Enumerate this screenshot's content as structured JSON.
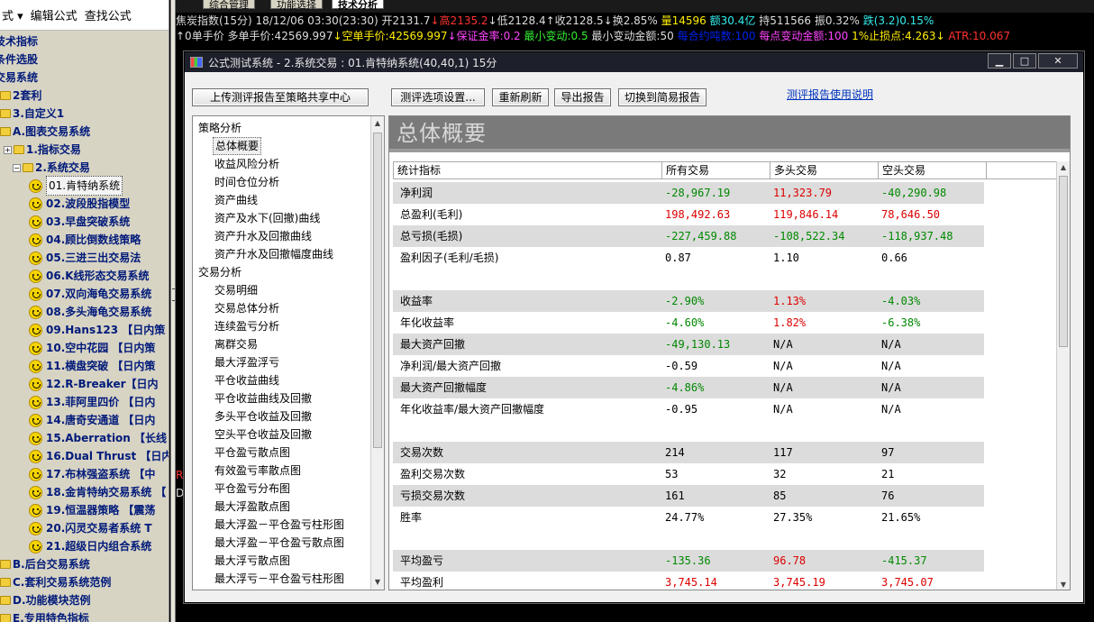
{
  "left_menu": [
    "式 ▾",
    "编辑公式",
    "查找公式"
  ],
  "tree": [
    {
      "label": "技术指标",
      "kind": "root"
    },
    {
      "label": "条件选股",
      "kind": "root"
    },
    {
      "label": "交易系统",
      "kind": "root"
    },
    {
      "label": "2套利",
      "kind": "folder"
    },
    {
      "label": "3.自定义1",
      "kind": "folder"
    },
    {
      "label": "A.图表交易系统",
      "kind": "folder-open"
    },
    {
      "label": "1.指标交易",
      "kind": "folder-sub"
    },
    {
      "label": "2.系统交易",
      "kind": "folder-sub-open"
    },
    {
      "label": "01.肯特纳系统",
      "kind": "sys",
      "selected": true
    },
    {
      "label": "02.波段股指模型",
      "kind": "sys"
    },
    {
      "label": "03.早盘突破系统",
      "kind": "sys"
    },
    {
      "label": "04.顾比倒数线策略",
      "kind": "sys"
    },
    {
      "label": "05.三进三出交易法",
      "kind": "sys"
    },
    {
      "label": "06.K线形态交易系统",
      "kind": "sys"
    },
    {
      "label": "07.双向海龟交易系统",
      "kind": "sys"
    },
    {
      "label": "08.多头海龟交易系统",
      "kind": "sys"
    },
    {
      "label": "09.Hans123 【日内策",
      "kind": "sys"
    },
    {
      "label": "10.空中花园 【日内策",
      "kind": "sys"
    },
    {
      "label": "11.横盘突破 【日内策",
      "kind": "sys"
    },
    {
      "label": "12.R-Breaker【日内",
      "kind": "sys"
    },
    {
      "label": "13.菲阿里四价 【日内",
      "kind": "sys"
    },
    {
      "label": "14.唐奇安通道 【日内",
      "kind": "sys"
    },
    {
      "label": "15.Aberration 【长线",
      "kind": "sys"
    },
    {
      "label": "16.Dual Thrust 【日内",
      "kind": "sys"
    },
    {
      "label": "17.布林强盗系统 【中",
      "kind": "sys"
    },
    {
      "label": "18.金肯特纳交易系统 【",
      "kind": "sys"
    },
    {
      "label": "19.恒温器策略 【震荡",
      "kind": "sys"
    },
    {
      "label": "20.闪灵交易者系统 T",
      "kind": "sys"
    },
    {
      "label": "21.超级日内组合系统",
      "kind": "sys"
    },
    {
      "label": "B.后台交易系统",
      "kind": "folder"
    },
    {
      "label": "C.套利交易系统范例",
      "kind": "folder"
    },
    {
      "label": "D.功能模块范例",
      "kind": "folder"
    },
    {
      "label": "E.专用特色指标",
      "kind": "folder"
    }
  ],
  "top_tabs": [
    "综合管理",
    "功能选择",
    "技术分析"
  ],
  "quote_line1": [
    {
      "t": "焦炭指数(15分) 18/12/06 03:30(23:30) 开2131.7",
      "c": "cw"
    },
    {
      "t": "↓高2135.2",
      "c": "cr"
    },
    {
      "t": "↓低2128.4",
      "c": "cw"
    },
    {
      "t": "↑收2128.5",
      "c": "cw"
    },
    {
      "t": "↓换2.85%",
      "c": "cw"
    },
    {
      "t": " 量14596",
      "c": "cy"
    },
    {
      "t": " 额30.4亿",
      "c": "cc"
    },
    {
      "t": " 持511566",
      "c": "cw"
    },
    {
      "t": " 振0.32%",
      "c": "cw"
    },
    {
      "t": " 跌(3.2)0.15%",
      "c": "cc"
    }
  ],
  "quote_line2": [
    {
      "t": "↑0单手价",
      "c": "cw"
    },
    {
      "t": " 多单手价:42569.997",
      "c": "cw"
    },
    {
      "t": "↓空单手价:42569.997",
      "c": "cy"
    },
    {
      "t": "↓保证金率:0.2",
      "c": "cm"
    },
    {
      "t": " 最小变动:0.5",
      "c": "cg"
    },
    {
      "t": " 最小变动金额:50",
      "c": "cw"
    },
    {
      "t": " 每合约吨数:100",
      "c": "cb"
    },
    {
      "t": " 每点变动金额:100",
      "c": "cm"
    },
    {
      "t": " 1%止损点:4.263↓",
      "c": "cy"
    },
    {
      "t": " ATR:10.067",
      "c": "cr"
    }
  ],
  "dialog": {
    "title": "公式测试系统 - 2.系统交易 : 01.肯特纳系统(40,40,1) 15分",
    "btn_min": "▁",
    "btn_max": "□",
    "btn_close": "✕",
    "toolbar": {
      "upload": "上传测评报告至策略共享中心",
      "options": "测评选项设置...",
      "refresh": "重新刷新",
      "export": "导出报告",
      "simple": "切换到简易报告",
      "help": "测评报告使用说明"
    }
  },
  "nav": {
    "groups": [
      {
        "label": "策略分析",
        "items": [
          "总体概要",
          "收益风险分析",
          "时间仓位分析",
          "资产曲线",
          "资产及水下(回撤)曲线",
          "资产升水及回撤曲线",
          "资产升水及回撤幅度曲线"
        ]
      },
      {
        "label": "交易分析",
        "items": [
          "交易明细",
          "交易总体分析",
          "连续盈亏分析",
          "离群交易",
          "最大浮盈浮亏",
          "平仓收益曲线",
          "平仓收益曲线及回撤",
          "多头平仓收益及回撤",
          "空头平仓收益及回撤",
          "平仓盈亏散点图",
          "有效盈亏率散点图",
          "平仓盈亏分布图",
          "最大浮盈散点图",
          "最大浮盈－平仓盈亏柱形图",
          "最大浮盈－平仓盈亏散点图",
          "最大浮亏散点图",
          "最大浮亏－平仓盈亏柱形图"
        ]
      }
    ],
    "selected": "总体概要"
  },
  "main": {
    "banner": "总体概要",
    "headers": [
      "统计指标",
      "所有交易",
      "多头交易",
      "空头交易"
    ],
    "rows": [
      {
        "label": "净利润",
        "v": [
          "-28,967.19",
          "11,323.79",
          "-40,290.98"
        ],
        "s": [
          "neg",
          "pos",
          "neg"
        ],
        "shade": true
      },
      {
        "label": "总盈利(毛利)",
        "v": [
          "198,492.63",
          "119,846.14",
          "78,646.50"
        ],
        "s": [
          "pos",
          "pos",
          "pos"
        ],
        "shade": false
      },
      {
        "label": "总亏损(毛损)",
        "v": [
          "-227,459.88",
          "-108,522.34",
          "-118,937.48"
        ],
        "s": [
          "neg",
          "neg",
          "neg"
        ],
        "shade": true
      },
      {
        "label": "盈利因子(毛利/毛损)",
        "v": [
          "0.87",
          "1.10",
          "0.66"
        ],
        "s": [
          "neu",
          "neu",
          "neu"
        ],
        "shade": false,
        "gap": true
      },
      {
        "label": "收益率",
        "v": [
          "-2.90%",
          "1.13%",
          "-4.03%"
        ],
        "s": [
          "neg",
          "pos",
          "neg"
        ],
        "shade": true
      },
      {
        "label": "年化收益率",
        "v": [
          "-4.60%",
          "1.82%",
          "-6.38%"
        ],
        "s": [
          "neg",
          "pos",
          "neg"
        ],
        "shade": false
      },
      {
        "label": "最大资产回撤",
        "v": [
          "-49,130.13",
          "N/A",
          "N/A"
        ],
        "s": [
          "neg",
          "neu",
          "neu"
        ],
        "shade": true
      },
      {
        "label": "净利润/最大资产回撤",
        "v": [
          "-0.59",
          "N/A",
          "N/A"
        ],
        "s": [
          "neu",
          "neu",
          "neu"
        ],
        "shade": false
      },
      {
        "label": "最大资产回撤幅度",
        "v": [
          "-4.86%",
          "N/A",
          "N/A"
        ],
        "s": [
          "neg",
          "neu",
          "neu"
        ],
        "shade": true
      },
      {
        "label": "年化收益率/最大资产回撤幅度",
        "v": [
          "-0.95",
          "N/A",
          "N/A"
        ],
        "s": [
          "neu",
          "neu",
          "neu"
        ],
        "shade": false,
        "gap": true
      },
      {
        "label": "交易次数",
        "v": [
          "214",
          "117",
          "97"
        ],
        "s": [
          "neu",
          "neu",
          "neu"
        ],
        "shade": true
      },
      {
        "label": "盈利交易次数",
        "v": [
          "53",
          "32",
          "21"
        ],
        "s": [
          "neu",
          "neu",
          "neu"
        ],
        "shade": false
      },
      {
        "label": "亏损交易次数",
        "v": [
          "161",
          "85",
          "76"
        ],
        "s": [
          "neu",
          "neu",
          "neu"
        ],
        "shade": true
      },
      {
        "label": "胜率",
        "v": [
          "24.77%",
          "27.35%",
          "21.65%"
        ],
        "s": [
          "neu",
          "neu",
          "neu"
        ],
        "shade": false,
        "gap": true
      },
      {
        "label": "平均盈亏",
        "v": [
          "-135.36",
          "96.78",
          "-415.37"
        ],
        "s": [
          "neg",
          "pos",
          "neg"
        ],
        "shade": true
      },
      {
        "label": "平均盈利",
        "v": [
          "3,745.14",
          "3,745.19",
          "3,745.07"
        ],
        "s": [
          "pos",
          "pos",
          "pos"
        ],
        "shade": false
      }
    ]
  },
  "bg_marks": [
    "R",
    "D"
  ]
}
